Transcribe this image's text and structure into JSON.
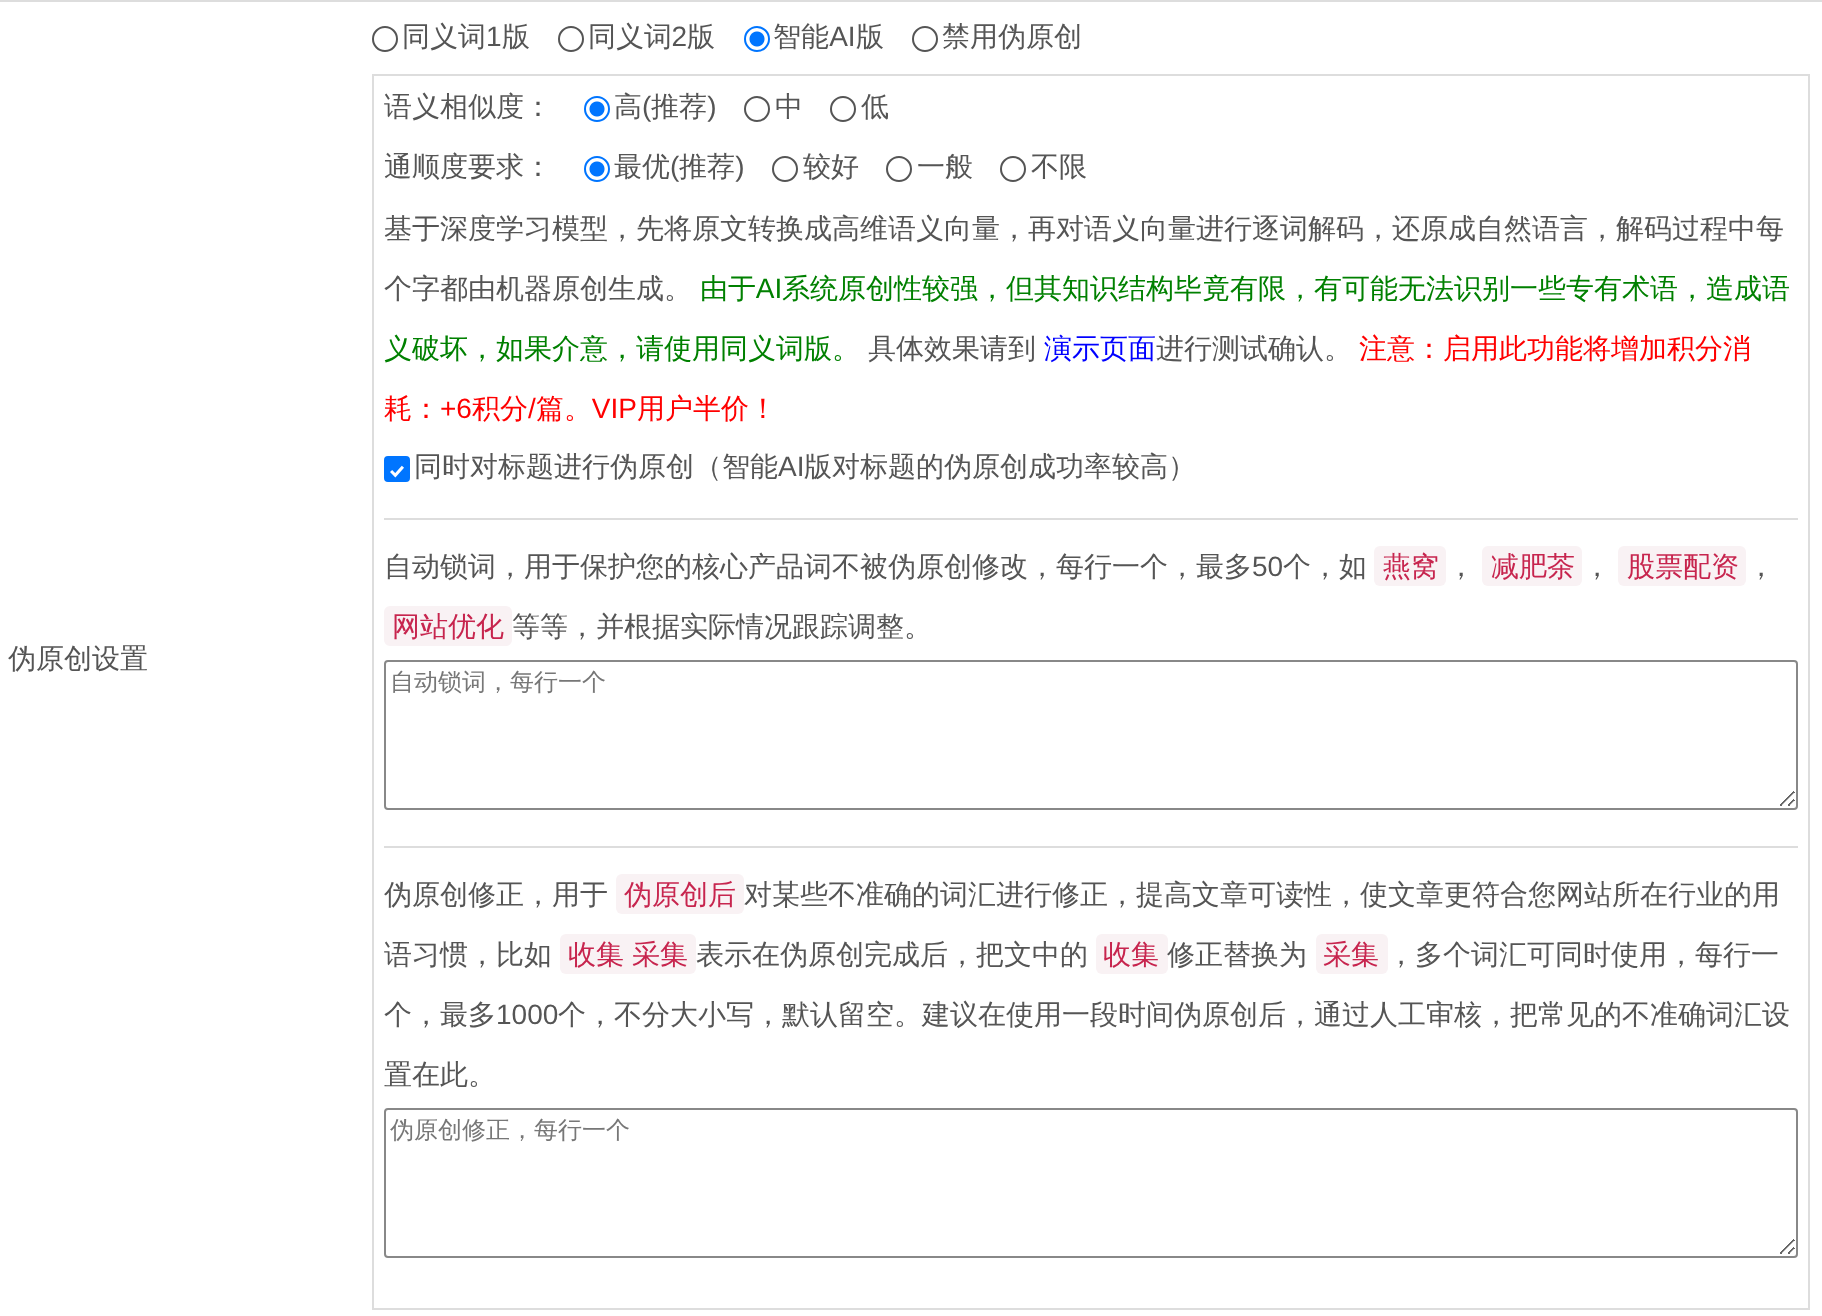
{
  "label": "伪原创设置",
  "modes": [
    {
      "label": "同义词1版",
      "selected": false
    },
    {
      "label": "同义词2版",
      "selected": false
    },
    {
      "label": "智能AI版",
      "selected": true
    },
    {
      "label": "禁用伪原创",
      "selected": false
    }
  ],
  "similarity": {
    "label": "语义相似度：",
    "options": [
      {
        "label": "高(推荐)",
        "selected": true
      },
      {
        "label": "中",
        "selected": false
      },
      {
        "label": "低",
        "selected": false
      }
    ]
  },
  "fluency": {
    "label": "通顺度要求：",
    "options": [
      {
        "label": "最优(推荐)",
        "selected": true
      },
      {
        "label": "较好",
        "selected": false
      },
      {
        "label": "一般",
        "selected": false
      },
      {
        "label": "不限",
        "selected": false
      }
    ]
  },
  "description": [
    {
      "kind": "text",
      "text": "基于深度学习模型，先将原文转换成高维语义向量，再对语义向量进行逐词解码，还原成自然语言，解码过程中每个字都由机器原创生成。"
    },
    {
      "kind": "note",
      "text": "由于AI系统原创性较强，但其知识结构毕竟有限，有可能无法识别一些专有术语，造成语义破坏，如果介意，请使用同义词版。"
    },
    {
      "kind": "text",
      "text": "具体效果请到"
    },
    {
      "kind": "link",
      "text": "演示页面"
    },
    {
      "kind": "text",
      "text": "进行测试确认。"
    },
    {
      "kind": "alert",
      "text": "注意：启用此功能将增加积分消耗：+6积分/篇。VIP用户半价！"
    }
  ],
  "title_option": {
    "label": "同时对标题进行伪原创（智能AI版对标题的伪原创成功率较高）",
    "checked": true
  },
  "lock_words": {
    "segments": [
      {
        "kind": "text",
        "text": "自动锁词，用于保护您的核心产品词不被伪原创修改，每行一个，最多50个，如"
      },
      {
        "kind": "tag",
        "text": "燕窝"
      },
      {
        "kind": "text",
        "text": "，"
      },
      {
        "kind": "tag",
        "text": "减肥茶"
      },
      {
        "kind": "text",
        "text": "，"
      },
      {
        "kind": "tag",
        "text": "股票配资"
      },
      {
        "kind": "text",
        "text": "，"
      },
      {
        "kind": "tag",
        "text": "网站优化"
      },
      {
        "kind": "text",
        "text": "等等，并根据实际情况跟踪调整。"
      }
    ],
    "placeholder": "自动锁词，每行一个"
  },
  "corrections": {
    "segments": [
      {
        "kind": "text",
        "text": "伪原创修正，用于"
      },
      {
        "kind": "tag",
        "text": "伪原创后"
      },
      {
        "kind": "text",
        "text": "对某些不准确的词汇进行修正，提高文章可读性，使文章更符合您网站所在行业的用语习惯，比如"
      },
      {
        "kind": "tag",
        "text": "收集 采集"
      },
      {
        "kind": "text",
        "text": "表示在伪原创完成后，把文中的"
      },
      {
        "kind": "tag",
        "text": "收集"
      },
      {
        "kind": "text",
        "text": "修正替换为"
      },
      {
        "kind": "tag",
        "text": "采集"
      },
      {
        "kind": "text",
        "text": "，多个词汇可同时使用，每行一个，最多1000个，不分大小写，默认留空。建议在使用一段时间伪原创后，通过人工审核，把常见的不准确词汇设置在此。"
      }
    ],
    "placeholder": "伪原创修正，每行一个"
  }
}
